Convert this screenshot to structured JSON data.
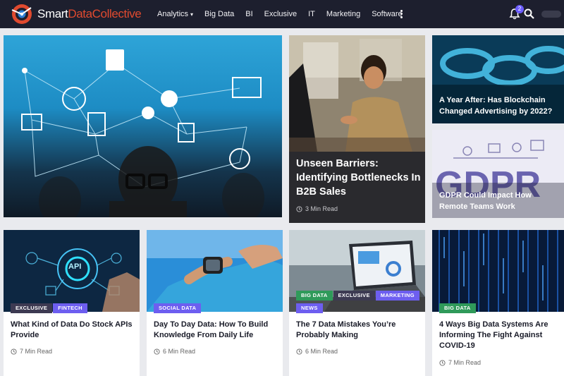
{
  "site": {
    "logo_part1": "Smart",
    "logo_part2": "Data",
    "logo_part3": "Collective"
  },
  "nav": {
    "items": [
      {
        "label": "Analytics",
        "dropdown": true
      },
      {
        "label": "Big Data"
      },
      {
        "label": "BI"
      },
      {
        "label": "Exclusive"
      },
      {
        "label": "IT"
      },
      {
        "label": "Marketing"
      },
      {
        "label": "Software"
      }
    ],
    "notification_count": "2",
    "icons": [
      "more-vertical-icon",
      "bell-icon",
      "search-icon"
    ]
  },
  "colors": {
    "topbar": "#1d1f2e",
    "brand_red": "#e04a2f",
    "tag_dark": "#3d3a52",
    "tag_purple": "#6d5ef0",
    "tag_green": "#2f9a5a",
    "badge": "#6b5cff"
  },
  "featured": {
    "center": {
      "title": "Unseen Barriers: Identifying Bottlenecks In B2B Sales",
      "read_time": "3 Min Read"
    },
    "right_top": {
      "title": "A Year After: Has Blockchain Changed Advertising by 2022?"
    },
    "right_bottom": {
      "title": "GDPR Could Impact How Remote Teams Work",
      "image_text": "GDPR"
    }
  },
  "articles": [
    {
      "title": "What Kind of Data Do Stock APIs Provide",
      "read_time": "7 Min Read",
      "tags": [
        {
          "label": "EXCLUSIVE",
          "style": "dark"
        },
        {
          "label": "FINTECH",
          "style": "purple"
        }
      ],
      "image_text": "API"
    },
    {
      "title": "Day To Day Data: How To Build Knowledge From Daily Life",
      "read_time": "6 Min Read",
      "tags": [
        {
          "label": "SOCIAL DATA",
          "style": "purple"
        }
      ]
    },
    {
      "title": "The 7 Data Mistakes You’re Probably Making",
      "read_time": "6 Min Read",
      "tags": [
        {
          "label": "BIG DATA",
          "style": "green"
        },
        {
          "label": "EXCLUSIVE",
          "style": "dark"
        },
        {
          "label": "MARKETING",
          "style": "purple"
        },
        {
          "label": "NEWS",
          "style": "purple"
        }
      ]
    },
    {
      "title": "4 Ways Big Data Systems Are Informing The Fight Against COVID-19",
      "read_time": "7 Min Read",
      "tags": [
        {
          "label": "BIG DATA",
          "style": "green"
        }
      ]
    }
  ]
}
